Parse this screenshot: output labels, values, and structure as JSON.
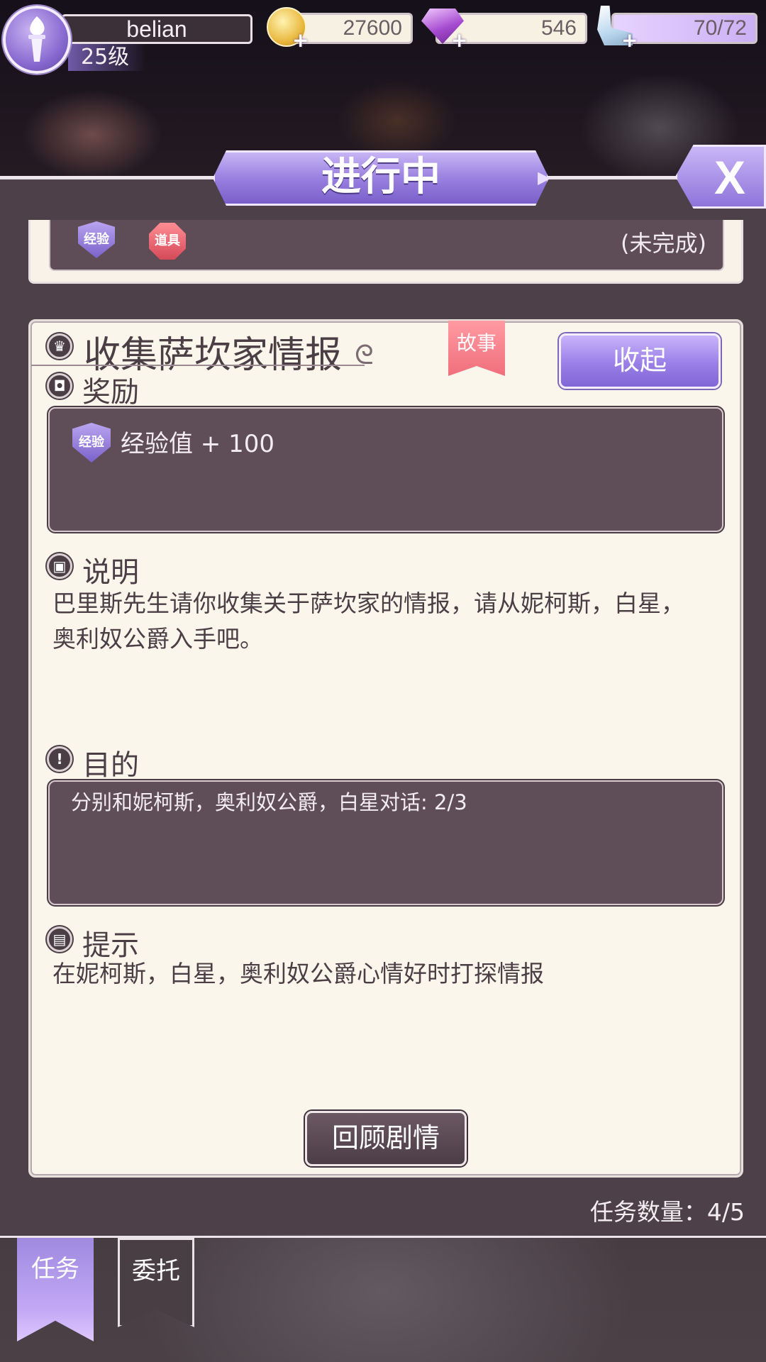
{
  "hud": {
    "player_name": "belian",
    "level": "25级",
    "coins": "27600",
    "gems": "546",
    "stamina": "70/72",
    "icons": [
      "torch-icon",
      "coin-icon",
      "gem-icon",
      "glass-slipper-icon"
    ]
  },
  "header": {
    "title": "进行中",
    "close_label": "X"
  },
  "prev_quest": {
    "badge_exp": "经验",
    "badge_item": "道具",
    "status": "(未完成)"
  },
  "quest": {
    "title": "收集萨坎家情报",
    "tag": "故事",
    "collapse_label": "收起",
    "reward_heading": "奖励",
    "reward_badge": "经验",
    "reward_text": "经验值 + 100",
    "description_heading": "说明",
    "description_line1": "巴里斯先生请你收集关于萨坎家的情报，请从妮柯斯，白星，",
    "description_line2": "奥利奴公爵入手吧。",
    "goal_heading": "目的",
    "goal_text": "分别和妮柯斯，奥利奴公爵，白星对话: 2/3",
    "hint_heading": "提示",
    "hint_text": "在妮柯斯，白星，奥利奴公爵心情好时打探情报",
    "review_label": "回顾剧情"
  },
  "footer": {
    "task_count": "任务数量：4/5"
  },
  "tabs": [
    {
      "label": "任务",
      "active": true
    },
    {
      "label": "委托",
      "active": false
    }
  ],
  "colors": {
    "accent_purple": "#9a80e0",
    "card_bg": "#fbf6ec",
    "dark_box": "#5f4d57",
    "story_tag": "#f06f7c"
  }
}
